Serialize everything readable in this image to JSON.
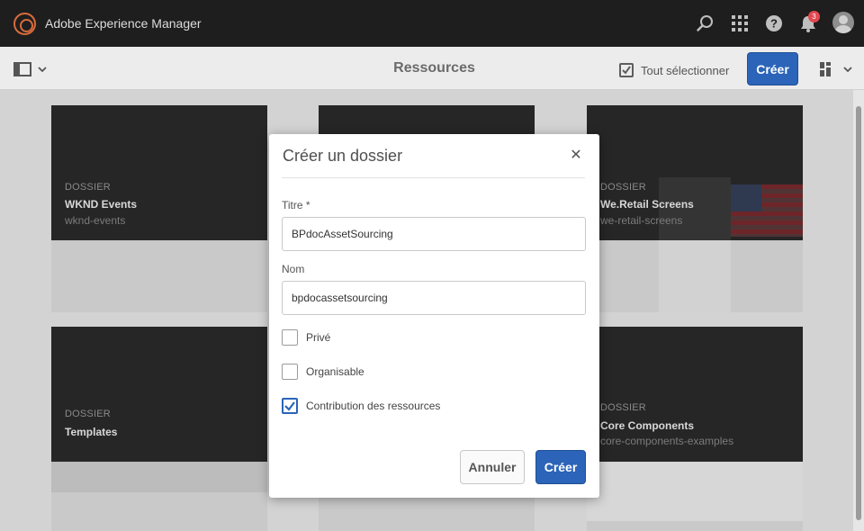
{
  "shell": {
    "app_title": "Adobe Experience Manager",
    "notification_count": "3",
    "icons": [
      "search-icon",
      "apps-grid-icon",
      "help-icon",
      "bell-icon",
      "avatar"
    ]
  },
  "actionbar": {
    "title": "Ressources",
    "select_all_label": "Tout sélectionner",
    "create_label": "Créer"
  },
  "cards": [
    {
      "type": "DOSSIER",
      "title": "WKND Events",
      "subtitle": "wknd-events"
    },
    {
      "type": "",
      "title": "",
      "subtitle": ""
    },
    {
      "type": "DOSSIER",
      "title": "We.Retail Screens",
      "subtitle": "we-retail-screens"
    },
    {
      "type": "DOSSIER",
      "title": "Templates",
      "subtitle": ""
    },
    {
      "type": "",
      "title": "",
      "subtitle": ""
    },
    {
      "type": "DOSSIER",
      "title": "Core Components",
      "subtitle": "core-components-examples"
    }
  ],
  "dialog": {
    "title": "Créer un dossier",
    "title_label": "Titre *",
    "title_value": "BPdocAssetSourcing",
    "name_label": "Nom",
    "name_value": "bpdocassetsourcing",
    "options": [
      {
        "label": "Privé",
        "checked": false
      },
      {
        "label": "Organisable",
        "checked": false
      },
      {
        "label": "Contribution des ressources",
        "checked": true
      }
    ],
    "cancel_label": "Annuler",
    "create_label": "Créer"
  },
  "colors": {
    "shell_bg": "#1e1e1e",
    "primary": "#2b64b8",
    "logo_accent": "#d86b3c",
    "badge": "#e34850"
  }
}
